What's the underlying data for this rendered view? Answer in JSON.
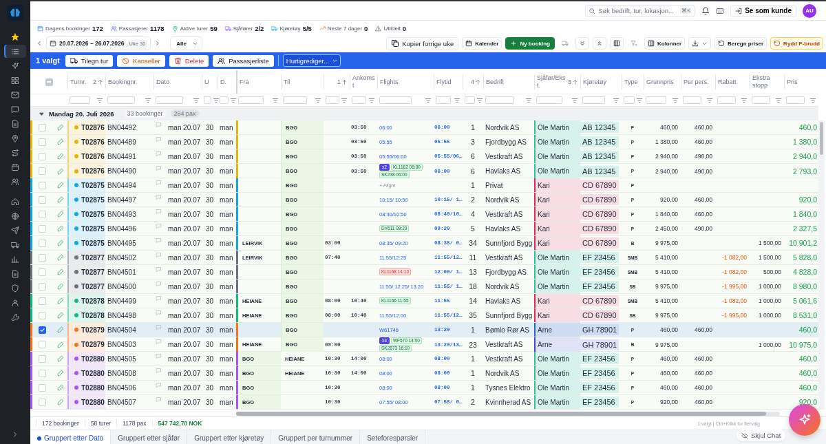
{
  "sidebar": {
    "primary": [
      {
        "kind": "star",
        "selected": false
      },
      {
        "kind": "list",
        "selected": true
      },
      {
        "kind": "sparkle",
        "selected": false
      },
      {
        "kind": "grid",
        "selected": false
      },
      {
        "kind": "mail",
        "selected": false
      },
      {
        "kind": "chat",
        "selected": false
      },
      {
        "kind": "document",
        "selected": false
      },
      {
        "kind": "pin",
        "selected": false
      },
      {
        "kind": "route",
        "selected": false
      },
      {
        "kind": "calendar",
        "selected": false
      },
      {
        "kind": "users",
        "selected": false
      }
    ],
    "secondary": [
      {
        "kind": "home",
        "selected": false
      },
      {
        "kind": "globe",
        "selected": false
      },
      {
        "kind": "send",
        "selected": false
      },
      {
        "kind": "truck",
        "selected": false
      },
      {
        "kind": "chart",
        "selected": false
      },
      {
        "kind": "document",
        "selected": false
      },
      {
        "kind": "shield",
        "selected": false
      },
      {
        "kind": "user",
        "selected": false
      },
      {
        "kind": "wrench",
        "selected": false
      }
    ]
  },
  "topbar": {
    "search_placeholder": "Søk bedrift, tur, lokasjon...",
    "shortcut": "⌘K",
    "view_as": "Se som kunde",
    "avatar": "AU"
  },
  "stats": [
    {
      "kind": "bookings",
      "label": "Dagens bookinger",
      "value": "172"
    },
    {
      "kind": "passengers",
      "label": "Passasjerer",
      "value": "1178"
    },
    {
      "kind": "tours",
      "label": "Aktive turer",
      "value": "59"
    },
    {
      "kind": "drivers",
      "label": "Sjåfører",
      "value": "2/2"
    },
    {
      "kind": "vehicles",
      "label": "Kjøretøy",
      "value": "5/5"
    },
    {
      "kind": "forecast",
      "label": "Neste 7 dager",
      "value": "0"
    },
    {
      "kind": "unassigned",
      "label": "Utildelt",
      "value": "0"
    }
  ],
  "nav": {
    "date_range": "20.07.2026 – 26.07.2026",
    "week": "Uke 30",
    "filter": "Alle"
  },
  "actions": [
    {
      "kind": "copy",
      "label": "Kopier forrige uke",
      "disabled": false
    },
    {
      "kind": "calendar",
      "label": "Kalender",
      "disabled": false
    },
    {
      "kind": "plus",
      "label": "Ny booking",
      "disabled": false
    },
    {
      "kind": "truck",
      "disabled": true
    },
    {
      "kind": "chevrons-down",
      "disabled": false
    },
    {
      "kind": "chevrons-up",
      "disabled": false
    },
    {
      "kind": "columns",
      "disabled": false
    },
    {
      "kind": "filter-x",
      "disabled": true
    },
    {
      "kind": "columns",
      "label": "Kolonner",
      "disabled": false
    },
    {
      "kind": "download",
      "disabled": false
    },
    {
      "kind": "refresh",
      "label": "Beregn priser",
      "disabled": false
    },
    {
      "kind": "reset",
      "label": "Rydd P-brudd",
      "disabled": false
    }
  ],
  "selection": {
    "count": "1 valgt",
    "buttons": [
      {
        "kind": "truck",
        "label": "Tilegn tur"
      },
      {
        "kind": "ban",
        "label": "Kanseller"
      },
      {
        "kind": "trash",
        "label": "Delete"
      },
      {
        "kind": "users",
        "label": "Passasjerliste"
      }
    ],
    "quick_edit": "Hurtigrediger..."
  },
  "table": {
    "select_all": {
      "indeterminate": true
    },
    "columns": [
      {
        "label": "Turnr.",
        "sort": "2"
      },
      {
        "label": "Bookingnr."
      },
      {
        "label": "Dato"
      },
      {
        "label": "U"
      },
      {
        "label": "D."
      },
      {
        "label": "Fra"
      },
      {
        "label": "Til"
      },
      {
        "sort": "1"
      },
      {
        "label": "Ankomst"
      },
      {
        "label": "Flights"
      },
      {
        "label": "Flytid"
      },
      {
        "sort": "4"
      },
      {
        "label": "Bedrift"
      },
      {
        "label": "Sjåfør/Ekst.",
        "sort": "3"
      },
      {
        "label": "Kjøretøy"
      },
      {
        "label": "Type"
      },
      {
        "label": "Grunnpris"
      },
      {
        "label": "Per pers."
      },
      {
        "label": "Rabatt"
      },
      {
        "label": "Ekstra stopp"
      },
      {
        "label": "Pris"
      }
    ],
    "group": {
      "title": "Mandag 20. Juli 2026",
      "bookings": "33 bookinger",
      "pax": "284 pax",
      "expanded": true
    },
    "rows": [
      {
        "checked": false,
        "tour": {
          "number": "T02876",
          "color": "#eab308"
        },
        "booking": "BN04492",
        "date": "man 20.07",
        "week": "30",
        "day": "man",
        "to": {
          "name": "BGO",
          "kind": "airport"
        },
        "arrival": "03:50",
        "flights": [
          {
            "kind": "time",
            "text": "06:00"
          }
        ],
        "flight_time": "06:00",
        "pax": "1",
        "company": "Nordvik AS",
        "driver": {
          "name": "Ole Martin",
          "color": "#d5f3ec"
        },
        "vehicle": "AB 12345",
        "type": "P",
        "base_price": "460,00",
        "per_person": "460,00",
        "price": "460,0"
      },
      {
        "checked": false,
        "tour": {
          "number": "T02876",
          "color": "#eab308"
        },
        "booking": "BN04489",
        "date": "man 20.07",
        "week": "30",
        "day": "man",
        "to": {
          "name": "BGO",
          "kind": "airport"
        },
        "arrival": "03:50",
        "flights": [
          {
            "kind": "time",
            "text": "05:55"
          }
        ],
        "flight_time": "05:55",
        "pax": "3",
        "company": "Fjordbygg AS",
        "driver": {
          "name": "Ole Martin",
          "color": "#d5f3ec"
        },
        "vehicle": "AB 12345",
        "type": "P",
        "base_price": "1 380,00",
        "per_person": "460,00",
        "price": "1 380,0"
      },
      {
        "checked": false,
        "tour": {
          "number": "T02876",
          "color": "#eab308"
        },
        "booking": "BN04491",
        "date": "man 20.07",
        "week": "30",
        "day": "man",
        "to": {
          "name": "BGO",
          "kind": "airport"
        },
        "arrival": "03:50",
        "flights": [
          {
            "kind": "time",
            "text": "05:55/06:00"
          }
        ],
        "flight_time": "05:55/06…",
        "pax": "6",
        "company": "Vestkraft AS",
        "driver": {
          "name": "Ole Martin",
          "color": "#d5f3ec"
        },
        "vehicle": "AB 12345",
        "type": "P",
        "base_price": "2 940,00",
        "per_person": "490,00",
        "price": "2 940,0"
      },
      {
        "checked": false,
        "tour": {
          "number": "T02876",
          "color": "#eab308"
        },
        "booking": "BN04490",
        "date": "man 20.07",
        "week": "30",
        "day": "man",
        "to": {
          "name": "BGO",
          "kind": "airport"
        },
        "arrival": "03:50",
        "flights": [
          {
            "kind": "count",
            "text": "x2"
          },
          {
            "kind": "tag",
            "text": "KL1162 06:00"
          },
          {
            "kind": "tag",
            "text": "SK238 06:00"
          }
        ],
        "flight_time": "06:00",
        "pax": "6",
        "company": "Havlaks AS",
        "driver": {
          "name": "Ole Martin",
          "color": "#d5f3ec"
        },
        "vehicle": "AB 12345",
        "type": "P",
        "base_price": "2 940,00",
        "per_person": "490,00",
        "price": "2 793,0"
      },
      {
        "checked": false,
        "tour": {
          "number": "T02875",
          "color": "#0ea5e9"
        },
        "booking": "BN04494",
        "date": "man 20.07",
        "week": "30",
        "day": "man",
        "to": {
          "name": "BGO",
          "kind": "airport"
        },
        "flights": [
          {
            "kind": "add",
            "text": "+ Flight"
          }
        ],
        "pax": "1",
        "company": "Privat",
        "driver": {
          "name": "Kari",
          "color": "#f8dde5"
        },
        "vehicle": "CD 67890",
        "type": "P"
      },
      {
        "checked": false,
        "tour": {
          "number": "T02875",
          "color": "#0ea5e9"
        },
        "booking": "BN04497",
        "date": "man 20.07",
        "week": "30",
        "day": "man",
        "to": {
          "name": "BGO",
          "kind": "airport"
        },
        "flights": [
          {
            "kind": "time",
            "text": "10:15/ 10:50"
          }
        ],
        "flight_time": "10:15/ 1…",
        "pax": "2",
        "company": "Nordvik AS",
        "driver": {
          "name": "Kari",
          "color": "#f8dde5"
        },
        "vehicle": "CD 67890",
        "type": "P",
        "base_price": "920,00",
        "per_person": "460,00",
        "price": "920,0"
      },
      {
        "checked": false,
        "tour": {
          "number": "T02875",
          "color": "#0ea5e9"
        },
        "booking": "BN04493",
        "date": "man 20.07",
        "week": "30",
        "day": "man",
        "to": {
          "name": "BGO",
          "kind": "airport"
        },
        "flights": [
          {
            "kind": "time",
            "text": "08:40/10:50"
          }
        ],
        "flight_time": "08:40/10…",
        "pax": "4",
        "company": "Vestkraft AS",
        "driver": {
          "name": "Kari",
          "color": "#f8dde5"
        },
        "vehicle": "CD 67890",
        "type": "P",
        "base_price": "1 840,00",
        "per_person": "460,00",
        "price": "1 840,0"
      },
      {
        "checked": false,
        "tour": {
          "number": "T02875",
          "color": "#0ea5e9"
        },
        "booking": "BN04496",
        "date": "man 20.07",
        "week": "30",
        "day": "man",
        "to": {
          "name": "BGO",
          "kind": "airport"
        },
        "flights": [
          {
            "kind": "tag",
            "text": "DY611 09:20"
          }
        ],
        "flight_time": "09:20",
        "pax": "5",
        "company": "Havlaks AS",
        "driver": {
          "name": "Kari",
          "color": "#f8dde5"
        },
        "vehicle": "CD 67890",
        "type": "P",
        "base_price": "2 450,00",
        "per_person": "490,00",
        "price": "2 327,5"
      },
      {
        "checked": false,
        "tour": {
          "number": "T02875",
          "color": "#0ea5e9"
        },
        "booking": "BN04495",
        "date": "man 20.07",
        "week": "30",
        "day": "man",
        "from": {
          "name": "LEIRVIK",
          "kind": "place"
        },
        "to": {
          "name": "BGO",
          "kind": "airport"
        },
        "departure": "03:00",
        "flights": [
          {
            "kind": "time",
            "text": "08:35/ 09:20"
          }
        ],
        "flight_time": "08:35/ 0…",
        "pax": "34",
        "company": "Sunnfjord Bygg",
        "driver": {
          "name": "Kari",
          "color": "#f8dde5"
        },
        "vehicle": "CD 67890",
        "type": "B",
        "base_price": "9 975,00",
        "extra_stop": "1 500,00",
        "price": "10 901,2"
      },
      {
        "checked": false,
        "tour": {
          "number": "T02877",
          "color": "#6b7280"
        },
        "booking": "BN04502",
        "date": "man 20.07",
        "week": "30",
        "day": "man",
        "from": {
          "name": "LEIRVIK",
          "kind": "place"
        },
        "to": {
          "name": "BGO",
          "kind": "airport"
        },
        "departure": "07:40",
        "flights": [
          {
            "kind": "time",
            "text": "11:55/12:25"
          }
        ],
        "flight_time": "11:55/12…",
        "pax": "11",
        "company": "Vestkraft AS",
        "driver": {
          "name": "Ole Martin",
          "color": "#d5f3ec"
        },
        "vehicle": "EF 23456",
        "type": "SMB",
        "base_price": "5 410,00",
        "discount": "-1 082,00",
        "extra_stop": "1 500,00",
        "price": "5 828,0"
      },
      {
        "checked": false,
        "tour": {
          "number": "T02877",
          "color": "#6b7280"
        },
        "booking": "BN04501",
        "date": "man 20.07",
        "week": "30",
        "day": "man",
        "to": {
          "name": "BGO",
          "kind": "airport"
        },
        "flights": [
          {
            "kind": "alert",
            "text": "KL1168 14:10"
          }
        ],
        "flight_time": "12:00/ 1…",
        "pax": "13",
        "company": "Fjordbygg AS",
        "driver": {
          "name": "Ole Martin",
          "color": "#d5f3ec"
        },
        "vehicle": "EF 23456",
        "type": "SMB",
        "base_price": "5 410,00",
        "discount": "-1 082,00",
        "extra_stop": "500,00",
        "price": "4 828,0"
      },
      {
        "checked": false,
        "tour": {
          "number": "T02877",
          "color": "#6b7280"
        },
        "booking": "BN04500",
        "date": "man 20.07",
        "week": "30",
        "day": "man",
        "to": {
          "name": "BGO",
          "kind": "airport"
        },
        "flights": [
          {
            "kind": "time",
            "text": "11:55/ 12:25/ 13:20"
          }
        ],
        "flight_time": "11:55/ 1…",
        "pax": "18",
        "company": "Nordvik AS",
        "driver": {
          "name": "Ole Martin",
          "color": "#d5f3ec"
        },
        "vehicle": "EF 23456",
        "type": "SB",
        "base_price": "9 975,00",
        "discount": "-1 995,00",
        "extra_stop": "1 000,00",
        "price": "8 980,0"
      },
      {
        "checked": false,
        "tour": {
          "number": "T02878",
          "color": "#10b981"
        },
        "booking": "BN04499",
        "date": "man 20.07",
        "week": "30",
        "day": "man",
        "from": {
          "name": "HEIANE",
          "kind": "place"
        },
        "to": {
          "name": "BGO",
          "kind": "airport"
        },
        "departure": "08:00",
        "arrival": "10:40",
        "flights": [
          {
            "kind": "tag",
            "text": "KL1166 11:55"
          }
        ],
        "flight_time": "11:55",
        "pax": "14",
        "company": "Havlaks AS",
        "driver": {
          "name": "Kari",
          "color": "#f8dde5"
        },
        "vehicle": "CD 67890",
        "type": "SMB",
        "base_price": "5 410,00",
        "discount": "-1 082,00",
        "extra_stop": "1 000,00",
        "price": "5 061,6"
      },
      {
        "checked": false,
        "tour": {
          "number": "T02878",
          "color": "#10b981"
        },
        "booking": "BN04498",
        "date": "man 20.07",
        "week": "30",
        "day": "man",
        "from": {
          "name": "HEIANE",
          "kind": "place"
        },
        "to": {
          "name": "BGO",
          "kind": "airport"
        },
        "departure": "08:00",
        "arrival": "10:40",
        "flights": [
          {
            "kind": "time",
            "text": "11:55/12:00"
          }
        ],
        "flight_time": "11:55/12…",
        "pax": "35",
        "company": "Sunnfjord Bygg",
        "driver": {
          "name": "Kari",
          "color": "#f8dde5"
        },
        "vehicle": "CD 67890",
        "type": "SB",
        "base_price": "9 975,00",
        "discount": "-1 995,00",
        "extra_stop": "1 000,00",
        "price": "8 531,0"
      },
      {
        "checked": true,
        "tour": {
          "number": "T02879",
          "color": "#f97316"
        },
        "booking": "BN04504",
        "date": "man 20.07",
        "week": "30",
        "day": "man",
        "to": {
          "name": "BGO",
          "kind": "airport"
        },
        "flights": [
          {
            "kind": "time",
            "text": "W61746"
          }
        ],
        "flight_time": "13:20",
        "pax": "1",
        "company": "Bømlo Rør AS",
        "driver": {
          "name": "Arne",
          "color": "#cddcf3"
        },
        "vehicle": "GH 78901",
        "type": "P",
        "base_price": "460,00",
        "per_person": "460,00",
        "price": "460,0"
      },
      {
        "checked": false,
        "tour": {
          "number": "T02879",
          "color": "#f97316"
        },
        "booking": "BN04503",
        "date": "man 20.07",
        "week": "30",
        "day": "man",
        "from": {
          "name": "HEIANE",
          "kind": "place"
        },
        "to": {
          "name": "BGO",
          "kind": "airport"
        },
        "departure": "09:00",
        "flights": [
          {
            "kind": "count",
            "text": "x3"
          },
          {
            "kind": "tag",
            "text": "WF570 14:00"
          },
          {
            "kind": "tag",
            "text": "SK2873 16:10"
          }
        ],
        "flight_time": "13:20/13…",
        "pax": "23",
        "company": "Vestkraft AS",
        "driver": {
          "name": "Arne",
          "color": "#e0e3f6"
        },
        "vehicle": "GH 78901",
        "type": "B",
        "base_price": "9 975,00",
        "extra_stop": "1 000,00",
        "price": "10 975,0"
      },
      {
        "checked": false,
        "tour": {
          "number": "T02880",
          "color": "#a855f7"
        },
        "booking": "BN04505",
        "date": "man 20.07",
        "week": "30",
        "day": "man",
        "from": {
          "name": "BGO",
          "kind": "airport"
        },
        "to": {
          "name": "HEIANE",
          "kind": "place"
        },
        "departure": "10:30",
        "arrival": "14:00",
        "flights": [
          {
            "kind": "time",
            "text": "08:00"
          }
        ],
        "flight_time": "08:00",
        "pax": "1",
        "company": "Vestkraft AS",
        "driver": {
          "name": "Ole Martin",
          "color": "#d5f3ec"
        },
        "vehicle": "EF 23456",
        "type": "P",
        "base_price": "460,00",
        "per_person": "460,00",
        "price": "460,0"
      },
      {
        "checked": false,
        "tour": {
          "number": "T02880",
          "color": "#a855f7"
        },
        "booking": "BN04508",
        "date": "man 20.07",
        "week": "30",
        "day": "man",
        "from": {
          "name": "BGO",
          "kind": "airport"
        },
        "to": {
          "name": "HEIANE",
          "kind": "place"
        },
        "departure": "10:30",
        "arrival": "14:00",
        "flights": [
          {
            "kind": "time",
            "text": "08:00"
          }
        ],
        "flight_time": "08:00",
        "pax": "1",
        "company": "Nordvik AS",
        "driver": {
          "name": "Ole Martin",
          "color": "#d5f3ec"
        },
        "vehicle": "EF 23456",
        "type": "P",
        "base_price": "460,00",
        "per_person": "460,00",
        "price": "460,0"
      },
      {
        "checked": false,
        "tour": {
          "number": "T02880",
          "color": "#a855f7"
        },
        "booking": "BN04506",
        "date": "man 20.07",
        "week": "30",
        "day": "man",
        "from": {
          "name": "BGO",
          "kind": "airport"
        },
        "departure": "10:30",
        "flights": [
          {
            "kind": "time",
            "text": "08:00"
          }
        ],
        "flight_time": "08:00",
        "pax": "1",
        "company": "Tysnes Elektro",
        "driver": {
          "name": "Ole Martin",
          "color": "#d5f3ec"
        },
        "vehicle": "EF 23456",
        "type": "P",
        "base_price": "460,00",
        "per_person": "460,00",
        "price": "460,0"
      },
      {
        "checked": false,
        "tour": {
          "number": "T02880",
          "color": "#a855f7"
        },
        "booking": "BN04507",
        "date": "man 20.07",
        "week": "30",
        "day": "man",
        "from": {
          "name": "BGO",
          "kind": "airport"
        },
        "departure": "10:30",
        "flights": [
          {
            "kind": "time",
            "text": "07:55/ 08:00"
          }
        ],
        "flight_time": "07:55/ 0…",
        "pax": "2",
        "company": "Kvinnherad AS",
        "driver": {
          "name": "Ole Martin",
          "color": "#d5f3ec"
        },
        "vehicle": "EF 23456",
        "type": "P",
        "base_price": "920,00",
        "per_person": "460,00",
        "price": "920,0"
      }
    ]
  },
  "footer": {
    "bookings": "172 bookinger",
    "tours": "58 turer",
    "pax": "1178 pax",
    "total": "547 742,70 NOK",
    "hint": "1 valgt | Ctrl+Klikk for flervalg"
  },
  "tabs": [
    {
      "label": "Gruppert etter Dato",
      "selected": true
    },
    {
      "label": "Gruppert etter sjåfør",
      "selected": false
    },
    {
      "label": "Gruppert etter kjøretøy",
      "selected": false
    },
    {
      "label": "Gruppert per turnummer",
      "selected": false
    },
    {
      "label": "Seteforespørsler",
      "selected": false
    }
  ],
  "chat": {
    "hide_label": "Skjul Chat"
  }
}
